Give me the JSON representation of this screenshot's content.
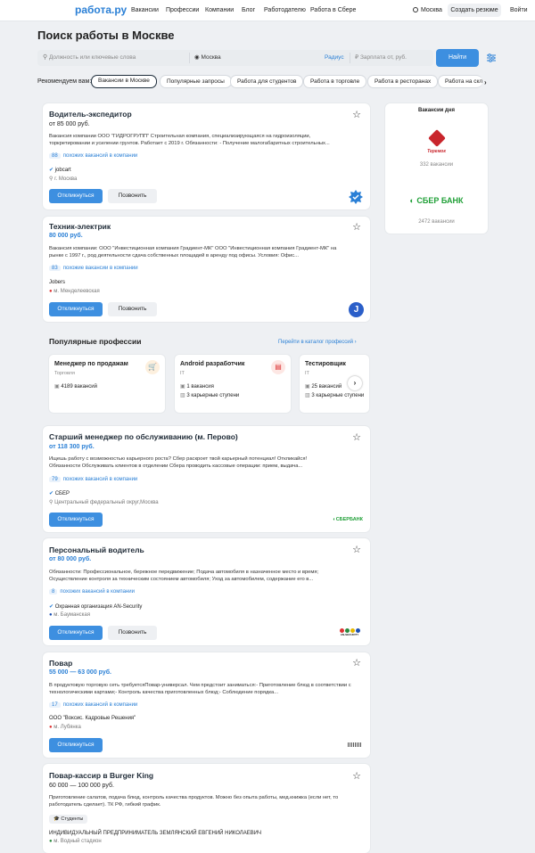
{
  "header": {
    "logo": "работа.ру",
    "nav": [
      "Вакансии",
      "Профессии",
      "Компании",
      "Блог",
      "Работодателю",
      "Работа в Сбере"
    ],
    "city": "Москва",
    "create_resume": "Создать резюме",
    "login": "Войти"
  },
  "page_title": "Поиск работы в Москве",
  "search": {
    "keyword_placeholder": "Должность или ключевые слова",
    "location": "Москва",
    "radius": "Радиус",
    "salary_placeholder": "Зарплата от, руб.",
    "find": "Найти"
  },
  "recommend": {
    "label": "Рекомендуем вам:",
    "chips": [
      "Вакансии в Москве",
      "Популярные запросы",
      "Работа для студентов",
      "Работа в торговле",
      "Работа в ресторанах",
      "Работа на скл"
    ]
  },
  "jobs": [
    {
      "title": "Водитель-экспедитор",
      "salary": "от 85 000 руб.",
      "desc1": "Вакансия компании ООО \"ГИДРОГРУПП\" Строительная компания, специализирующаяся на гидроизоляции,",
      "desc2": "торкретировании и усилении грунтов. Работает с 2019 г. Обязанности: - Получение малогабаритных строительных...",
      "similar_count": "88",
      "similar": "похожих вакансий в компании",
      "company": "jobcart",
      "location": "г. Москва",
      "apply": "Откликнуться",
      "call": "Позвонить"
    },
    {
      "title": "Техник-электрик",
      "salary": "80 000 руб.",
      "desc1": "Вакансия компании: ООО \"Инвестиционная компания Градиент-МК\" ООО \"Инвестиционная компания Градиент-МК\" на",
      "desc2": "рынке с 1997 г., род деятельности сдача собственных площадей в аренду под офисы. Условия: Офис...",
      "similar_count": "83",
      "similar": "похожие вакансии в компании",
      "company": "Jobers",
      "location": "м. Менделеевская",
      "apply": "Откликнуться",
      "call": "Позвонить"
    },
    {
      "title": "Старший менеджер по обслуживанию (м. Перово)",
      "salary": "от 118 300 руб.",
      "desc1": "Ищешь работу с возможностью карьерного роста? Сбер раскроет твой карьерный потенциал! Откликайся!",
      "desc2": "Обязанности Обслуживать клиентов в отделении Сбера проводить кассовые операции: прием, выдача...",
      "similar_count": "79",
      "similar": "похожих вакансий в компании",
      "company": "СБЕР",
      "location": "Центральный федеральный округ,Москва",
      "apply": "Откликнуться",
      "logo": "СБЕРБАНК"
    },
    {
      "title": "Персональный водитель",
      "salary": "от 80 000 руб.",
      "desc1": "Обязанности: Профессиональное, бережное передвижение; Подача автомобиля в назначенное место и время;",
      "desc2": "Осуществление контроля за техническим состоянием автомобиля; Уход за автомобилем, содержание его в...",
      "similar_count": "8",
      "similar": "похожих вакансий в компании",
      "company": "Охранная организация AN-Security",
      "location": "м. Бауманская",
      "apply": "Откликнуться",
      "call": "Позвонить",
      "logo": "AN-SECURITY"
    },
    {
      "title": "Повар",
      "salary": "55 000 — 63 000 руб.",
      "desc1": "В продуктовую торговую сеть требуетсяПовар-универсал. Чем предстоит заниматься:- Приготовление блюд в соответствии с",
      "desc2": "технологическими картами;- Контроль качества приготовленных блюд;- Соблюдение порядка...",
      "similar_count": "17",
      "similar": "похожих вакансий в компании",
      "company": "ООО \"Воксис. Кадровые Решения\"",
      "location": "м. Лубянка",
      "apply": "Откликнуться"
    },
    {
      "title": "Повар-кассир в Burger King",
      "salary": "60 000 — 100 000 руб.",
      "desc1": "Приготовление салатов, подача блюд, контроль качества продуктов. Можно без опыта работы, мед.книжка (если нет, то",
      "desc2": "работодатель сделает). ТК РФ, гибкий график.",
      "tag": "Студенты",
      "company": "ИНДИВИДУАЛЬНЫЙ ПРЕДПРИНИМАТЕЛЬ ЗЕМЛЯНСКИЙ ЕВГЕНИЙ НИКОЛАЕВИЧ",
      "location": "м. Водный стадион"
    }
  ],
  "sidebar": {
    "title": "Вакансии дня",
    "c1_logo": "Теремок",
    "c1_count": "332 вакансии",
    "c2_logo": "СБЕР БАНК",
    "c2_count": "2472 вакансии"
  },
  "popular": {
    "title": "Популярные профессии",
    "catalog": "Перейти в каталог профессий",
    "items": [
      {
        "title": "Менеджер по продажам",
        "cat": "Торговля",
        "l1": "4189 вакансий"
      },
      {
        "title": "Android разработчик",
        "cat": "IT",
        "l1": "1 вакансия",
        "l2": "3 карьерные ступени"
      },
      {
        "title": "Тестировщик",
        "cat": "IT",
        "l1": "25 вакансий",
        "l2": "3 карьерные ступени"
      }
    ]
  }
}
